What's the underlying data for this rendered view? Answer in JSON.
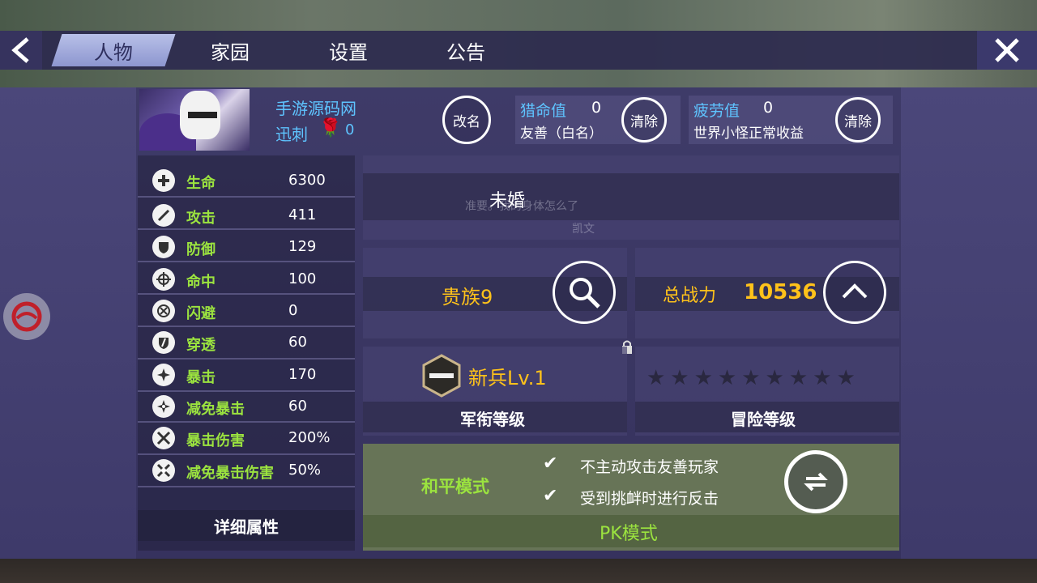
{
  "nav": {
    "tabs": [
      "人物",
      "家园",
      "设置",
      "公告"
    ],
    "active_tab": 0
  },
  "profile": {
    "server_name": "手游源码网",
    "char_name": "迅刺",
    "rose_count": "0",
    "rename_label": "改名"
  },
  "hunt": {
    "title": "猎命值",
    "value": "0",
    "desc": "友善（白名）",
    "clear_label": "清除"
  },
  "fatigue": {
    "title": "疲劳值",
    "value": "0",
    "desc": "世界小怪正常收益",
    "clear_label": "清除"
  },
  "stats": [
    {
      "label": "生命",
      "value": "6300",
      "icon": "plus-icon"
    },
    {
      "label": "攻击",
      "value": "411",
      "icon": "sword-icon"
    },
    {
      "label": "防御",
      "value": "129",
      "icon": "shield-icon"
    },
    {
      "label": "命中",
      "value": "100",
      "icon": "crosshair-icon"
    },
    {
      "label": "闪避",
      "value": "0",
      "icon": "dodge-icon"
    },
    {
      "label": "穿透",
      "value": "60",
      "icon": "pierce-icon"
    },
    {
      "label": "暴击",
      "value": "170",
      "icon": "burst-icon"
    },
    {
      "label": "减免暴击",
      "value": "60",
      "icon": "burst-reduce-icon"
    },
    {
      "label": "暴击伤害",
      "value": "200%",
      "icon": "crossed-swords-icon"
    },
    {
      "label": "减免暴击伤害",
      "value": "50%",
      "icon": "crossed-swords-reduce-icon"
    }
  ],
  "detail_label": "详细属性",
  "marriage": {
    "status": "未婚",
    "ghost_line1": "准要。我的身体怎么了",
    "ghost_line2": "凯文"
  },
  "noble": {
    "label": "贵族9"
  },
  "power": {
    "label": "总战力",
    "value": "10536"
  },
  "military": {
    "rank": "新兵Lv.1",
    "title": "军衔等级"
  },
  "adventure": {
    "title": "冒险等级",
    "stars": "★★★★★★★★★"
  },
  "pk": {
    "mode": "和平模式",
    "rules": [
      "不主动攻击友善玩家",
      "受到挑衅时进行反击"
    ],
    "title": "PK模式"
  },
  "colors": {
    "accent_blue": "#5ec4ff",
    "stat_green": "#9be33f",
    "gold": "#ffc21a"
  }
}
